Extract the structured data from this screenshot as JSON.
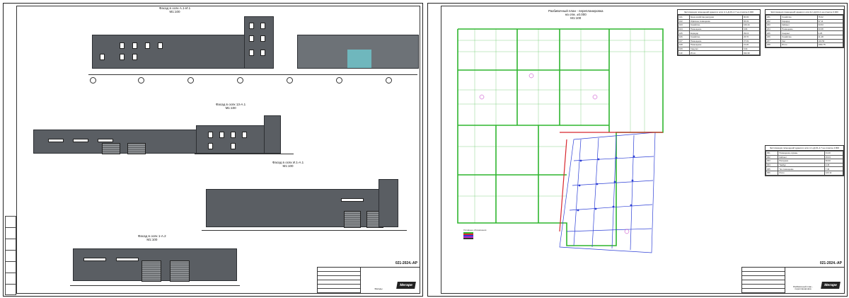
{
  "left_sheet": {
    "facades": [
      {
        "title": "Фасад в осях А.1-И.1",
        "scale": "М1:100"
      },
      {
        "title": "Фасад в осях 13-А.1",
        "scale": "М1:100"
      },
      {
        "title": "Фасад в осях И.1-А.1",
        "scale": "М1:100"
      },
      {
        "title": "Фасад в осях 1-А.2",
        "scale": "М1:100"
      }
    ],
    "stamp": {
      "code": "021-2024.-АР",
      "sheet_name": "Фасады",
      "logo": "Мегаре"
    }
  },
  "right_sheet": {
    "plan": {
      "title": "Разбивочный план - перепланировка",
      "subtitle": "на отм. ±0.000",
      "scale": "М1:100"
    },
    "legend_title": "Условные обозначения",
    "explications": [
      {
        "caption": "Экспликация помещений здания в осях А.1-Д.4/1-4.7 на отметке 0.000",
        "rows": [
          [
            "101",
            "Зона хозяйства разгрузки",
            "90.93"
          ],
          [
            "102",
            "Офисное помещение",
            "65.33"
          ],
          [
            "103",
            "Хозяйство",
            "100.44"
          ],
          [
            "104",
            "Помещение",
            "9.84"
          ],
          [
            "105",
            "Коридор",
            "39.13"
          ],
          [
            "106",
            "Хозяйство",
            "26.70"
          ],
          [
            "107",
            "Помещение",
            "37.49"
          ],
          [
            "108",
            "Помещение",
            "21.20"
          ],
          [
            "109",
            "Санузел",
            "9.64"
          ],
          [
            "110",
            "Итого",
            "924.30"
          ]
        ]
      },
      {
        "caption": "Экспликация помещений здания в осях Е.1-Д.4/4-1 на отметке 0.000",
        "rows": [
          [
            "201",
            "Хозяйство",
            "75.62"
          ],
          [
            "202",
            "Коридор",
            "97.11"
          ],
          [
            "203",
            "Кабинет",
            "34.53"
          ],
          [
            "204",
            "Помещение",
            "63.68"
          ],
          [
            "205",
            "Санузел",
            "9.25"
          ],
          [
            "206",
            "Хозяйство",
            "21.48"
          ],
          [
            "207",
            "Зал",
            "103.56"
          ],
          [
            "208",
            "Итого",
            "1061.75"
          ]
        ]
      },
      {
        "caption": "Экспликация помещений здания в осях А.1-Д.4/1-4.7 на отметке 4.800",
        "rows": [
          [
            "301",
            "Помещение охраны",
            "31.20"
          ],
          [
            "302",
            "Кабинет",
            "15.03"
          ],
          [
            "303",
            "Разгрузка",
            "60.60"
          ],
          [
            "304",
            "Тамбур",
            "9.45"
          ],
          [
            "305",
            "Тех помещение",
            "7.40"
          ],
          [
            "306",
            "Итого",
            "123.14"
          ]
        ]
      }
    ],
    "stamp": {
      "code": "021-2024.-АР",
      "sheet_name": "Разбивочный план - перепланировка",
      "logo": "Мегаре"
    }
  },
  "colors": {
    "facade": "#5a5e63",
    "plan_green": "#2fb62f",
    "plan_blue": "#2d3fd6",
    "plan_red": "#d8262d",
    "plan_magenta": "#c02bc4"
  }
}
